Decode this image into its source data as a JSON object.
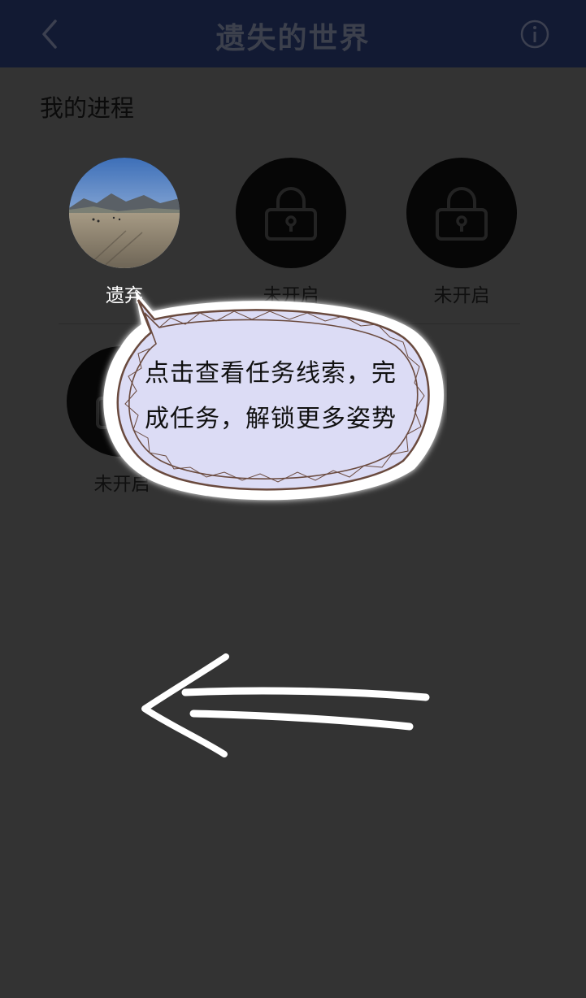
{
  "header": {
    "title": "遗失的世界",
    "back_icon": "chevron-left-icon",
    "info_icon": "info-icon"
  },
  "progress": {
    "title": "我的进程",
    "levels": [
      {
        "label": "遗弃",
        "state": "unlocked",
        "image": "landscape photo of plain with mountains"
      },
      {
        "label": "未开启",
        "state": "locked"
      },
      {
        "label": "未开启",
        "state": "locked"
      },
      {
        "label": "未开启",
        "state": "locked"
      }
    ]
  },
  "tooltip": {
    "text": "点击查看任务线索，完成任务，解锁更多姿势",
    "bubble_color": "#dcdcf5"
  },
  "colors": {
    "header_bg": "#121a33",
    "page_bg": "#333333"
  }
}
